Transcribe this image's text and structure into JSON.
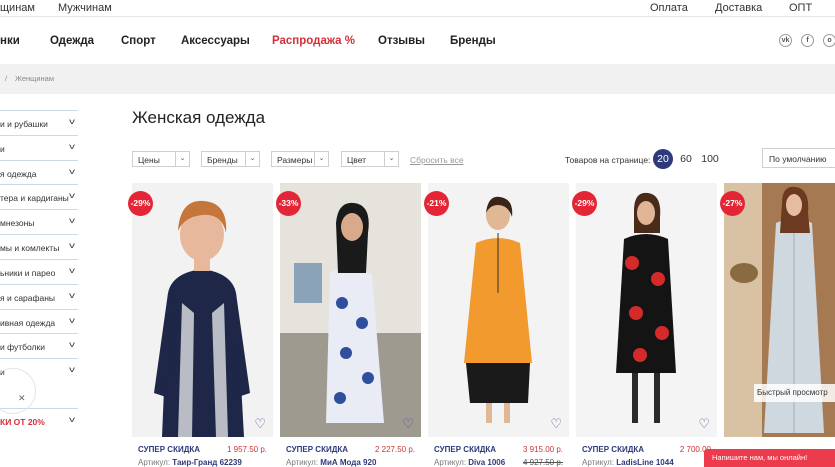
{
  "topbar": {
    "left": [
      "щинам",
      "Мужчинам"
    ],
    "right": [
      "Оплата",
      "Доставка",
      "ОПТ"
    ]
  },
  "nav": {
    "items": [
      "нки",
      "Одежда",
      "Спорт",
      "Аксессуары",
      "Распродажа %",
      "Отзывы",
      "Бренды"
    ],
    "social": [
      "vk-icon",
      "facebook-icon",
      "odnoklassniki-icon"
    ]
  },
  "breadcrumb": {
    "separator": "/",
    "current": "Женщинам"
  },
  "sidebar": {
    "items": [
      "и и рубашки",
      "и",
      "я одежда",
      "тера и кардиганы",
      "мнезоны",
      "мы и комлекты",
      "ьники и парео",
      "я и сарафаны",
      "ивная одежда",
      "и футболки",
      "и",
      "КИ ОТ 20%"
    ]
  },
  "page_title": "Женская одежда",
  "filters": {
    "dropdowns": [
      "Цены",
      "Бренды",
      "Размеры",
      "Цвет"
    ],
    "reset": "Сбросить все",
    "per_page_label": "Товаров на странице:",
    "per_page_options": [
      "20",
      "60",
      "100"
    ],
    "per_page_selected": "20",
    "sort": "По умолчанию"
  },
  "products": [
    {
      "discount": "-29%",
      "label": "СУПЕР СКИДКА",
      "price": "1 957.50 р.",
      "article_prefix": "Артикул:",
      "article": "Таир-Гранд 62239",
      "old_price": ""
    },
    {
      "discount": "-33%",
      "label": "СУПЕР СКИДКА",
      "price": "2 227.50 р.",
      "article_prefix": "Артикул:",
      "article": "МиА Мода 920",
      "old_price": ""
    },
    {
      "discount": "-21%",
      "label": "СУПЕР СКИДКА",
      "price": "3 915.00 р.",
      "article_prefix": "Артикул:",
      "article": "Diva 1006",
      "old_price": "4 927.50 р."
    },
    {
      "discount": "-29%",
      "label": "СУПЕР СКИДКА",
      "price": "2 700.00",
      "article_prefix": "Артикул:",
      "article": "LadisLine 1044",
      "old_price": ""
    },
    {
      "discount": "-27%",
      "label": "",
      "price": "",
      "article_prefix": "",
      "article": "",
      "old_price": ""
    }
  ],
  "quick_view": "Быстрый просмотр",
  "chat": "Напишите нам, мы онлайн!",
  "colors": {
    "accent": "#2d3a7c",
    "sale": "#e32636",
    "chat": "#ec3b4c"
  }
}
